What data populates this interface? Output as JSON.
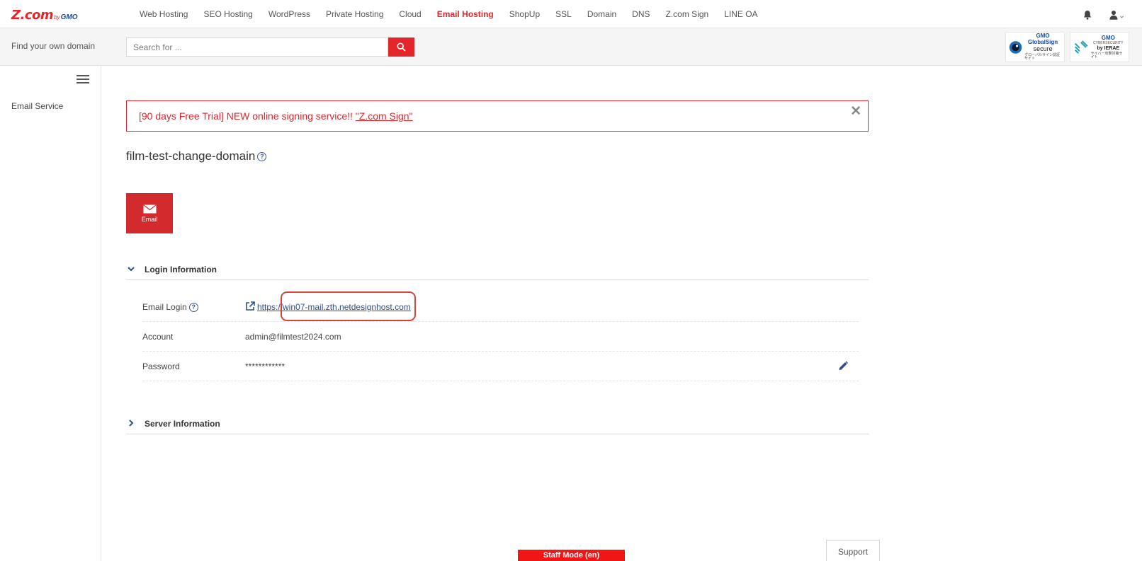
{
  "logo": {
    "main": "Z.com",
    "by": "by",
    "gmo": "GMO"
  },
  "nav": {
    "items": [
      {
        "label": "Web Hosting",
        "active": false
      },
      {
        "label": "SEO Hosting",
        "active": false
      },
      {
        "label": "WordPress",
        "active": false
      },
      {
        "label": "Private Hosting",
        "active": false
      },
      {
        "label": "Cloud",
        "active": false
      },
      {
        "label": "Email Hosting",
        "active": true
      },
      {
        "label": "ShopUp",
        "active": false
      },
      {
        "label": "SSL",
        "active": false
      },
      {
        "label": "Domain",
        "active": false
      },
      {
        "label": "DNS",
        "active": false
      },
      {
        "label": "Z.com Sign",
        "active": false
      },
      {
        "label": "LINE OA",
        "active": false
      }
    ],
    "icons": {
      "bell": "bell-icon",
      "user": "user-icon"
    }
  },
  "search": {
    "label": "Find your own domain",
    "placeholder": "Search for ...",
    "value": ""
  },
  "badges": {
    "globalsign": {
      "gmo": "GMO",
      "name": "GlobalSign",
      "secure": "secure",
      "jp": "グローバルサイン認証サイト"
    },
    "ierae": {
      "gmo": "GMO",
      "cyber": "CYBERSECURITY",
      "by": "by IERAE",
      "jp": "サイバー攻撃対策サイト"
    }
  },
  "sidebar": {
    "items": [
      {
        "label": "Email Service"
      }
    ]
  },
  "banner": {
    "text": "[90 days Free Trial] NEW online signing service!! ",
    "link_text": "\"Z.com Sign\"",
    "close": "✕"
  },
  "domain": {
    "title": "film-test-change-domain"
  },
  "tile": {
    "label": "Email"
  },
  "login_section": {
    "title": "Login Information",
    "rows": {
      "email_login": {
        "label": "Email Login",
        "value": "https://win07-mail.zth.netdesignhost.com"
      },
      "account": {
        "label": "Account",
        "value": "admin@filmtest2024.com"
      },
      "password": {
        "label": "Password",
        "value": "************"
      }
    }
  },
  "server_section": {
    "title": "Server Information"
  },
  "footer": {
    "staff_mode": "Staff Mode (en)",
    "support": "Support"
  },
  "colors": {
    "brand_red": "#e4262b",
    "link_blue": "#2f4e86",
    "tile_red": "#d32a2e"
  }
}
